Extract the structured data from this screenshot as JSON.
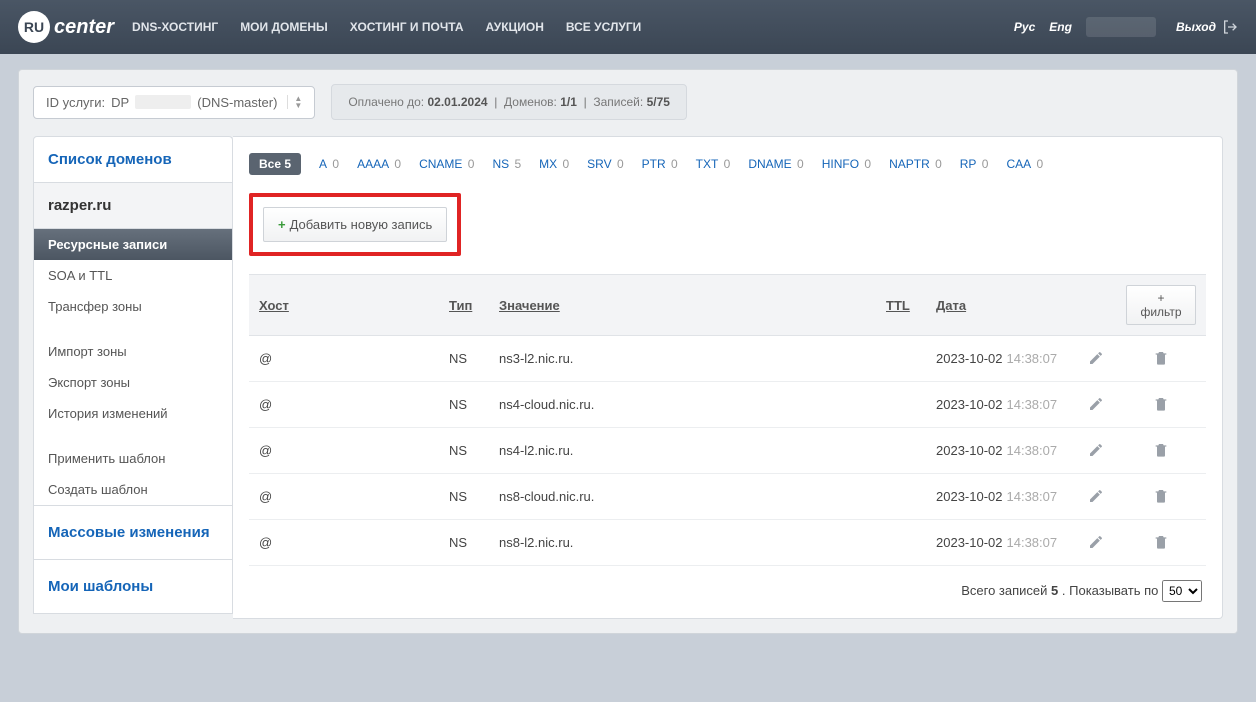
{
  "brand": {
    "badge": "RU",
    "name": "center"
  },
  "topnav": [
    "DNS-ХОСТИНГ",
    "МОИ ДОМЕНЫ",
    "ХОСТИНГ И ПОЧТА",
    "АУКЦИОН",
    "ВСЕ УСЛУГИ"
  ],
  "lang": {
    "ru": "Рус",
    "en": "Eng"
  },
  "exit_label": "Выход",
  "service": {
    "label": "ID услуги:",
    "prefix": "DP",
    "suffix": "(DNS-master)"
  },
  "info": {
    "paid_label": "Оплачено до:",
    "paid_value": "02.01.2024",
    "domains_label": "Доменов:",
    "domains_value": "1/1",
    "records_label": "Записей:",
    "records_value": "5/75"
  },
  "side": {
    "list_title": "Список доменов",
    "domain": "razper.ru",
    "menu": [
      "Ресурсные записи",
      "SOA и TTL",
      "Трансфер зоны",
      "Импорт зоны",
      "Экспорт зоны",
      "История изменений",
      "Применить шаблон",
      "Создать шаблон"
    ],
    "mass": "Массовые изменения",
    "templates": "Мои шаблоны"
  },
  "types": [
    {
      "name": "Все",
      "count": 5,
      "active": true
    },
    {
      "name": "A",
      "count": 0
    },
    {
      "name": "AAAA",
      "count": 0
    },
    {
      "name": "CNAME",
      "count": 0
    },
    {
      "name": "NS",
      "count": 5
    },
    {
      "name": "MX",
      "count": 0
    },
    {
      "name": "SRV",
      "count": 0
    },
    {
      "name": "PTR",
      "count": 0
    },
    {
      "name": "TXT",
      "count": 0
    },
    {
      "name": "DNAME",
      "count": 0
    },
    {
      "name": "HINFO",
      "count": 0
    },
    {
      "name": "NAPTR",
      "count": 0
    },
    {
      "name": "RP",
      "count": 0
    },
    {
      "name": "CAA",
      "count": 0
    }
  ],
  "add_label": "Добавить новую запись",
  "columns": {
    "host": "Хост",
    "type": "Тип",
    "value": "Значение",
    "ttl": "TTL",
    "date": "Дата",
    "filter": "+ фильтр"
  },
  "rows": [
    {
      "host": "@",
      "type": "NS",
      "value": "ns3-l2.nic.ru.",
      "date": "2023-10-02",
      "time": "14:38:07"
    },
    {
      "host": "@",
      "type": "NS",
      "value": "ns4-cloud.nic.ru.",
      "date": "2023-10-02",
      "time": "14:38:07"
    },
    {
      "host": "@",
      "type": "NS",
      "value": "ns4-l2.nic.ru.",
      "date": "2023-10-02",
      "time": "14:38:07"
    },
    {
      "host": "@",
      "type": "NS",
      "value": "ns8-cloud.nic.ru.",
      "date": "2023-10-02",
      "time": "14:38:07"
    },
    {
      "host": "@",
      "type": "NS",
      "value": "ns8-l2.nic.ru.",
      "date": "2023-10-02",
      "time": "14:38:07"
    }
  ],
  "pager": {
    "total_label": "Всего записей",
    "total": "5",
    "show_label": ". Показывать по",
    "per_page": "50"
  }
}
